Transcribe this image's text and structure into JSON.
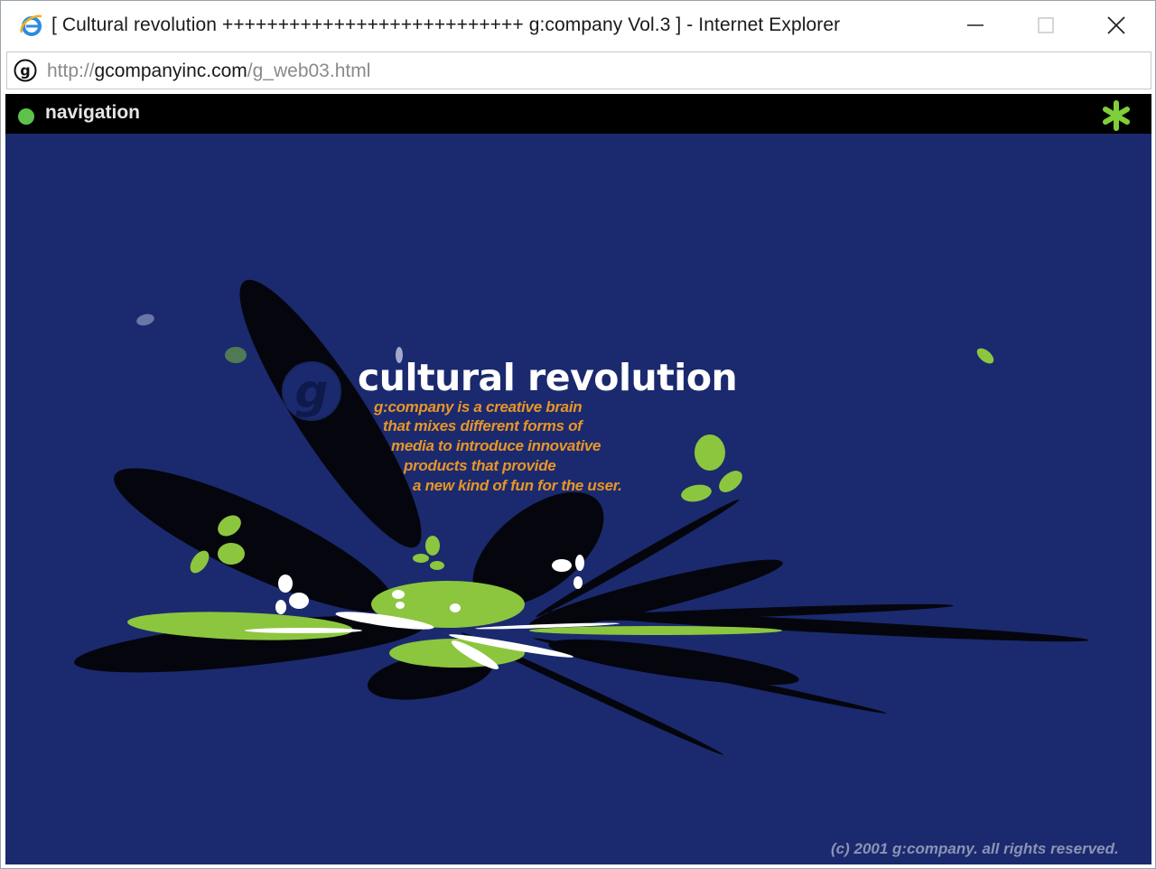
{
  "window": {
    "title": "[ Cultural revolution +++++++++++++++++++++++++++ g:company Vol.3 ] - Internet Explorer",
    "minimize_label": "",
    "maximize_label": "",
    "close_label": ""
  },
  "address": {
    "scheme": "http://",
    "host": "gcompanyinc.com",
    "path": "/g_web03.html"
  },
  "page": {
    "nav_label": "navigation",
    "headline": "cultural revolution",
    "tagline": [
      "g:company is a creative brain",
      "that mixes different forms of",
      "media to introduce innovative",
      "products that provide",
      "a new kind of fun for the user."
    ],
    "copyright": "(c) 2001 g:company. all rights reserved."
  },
  "icons": {
    "browser": "internet-explorer-icon",
    "site": "g-company-favicon",
    "nav": "green-dot-icon",
    "menu": "green-asterisk-icon",
    "logo": "g-company-logo"
  },
  "colors": {
    "page_background": "#1b2a6e",
    "nav_background": "#000000",
    "accent_green": "#8cc63f",
    "tagline_orange": "#e89527",
    "headline": "#ffffff"
  }
}
